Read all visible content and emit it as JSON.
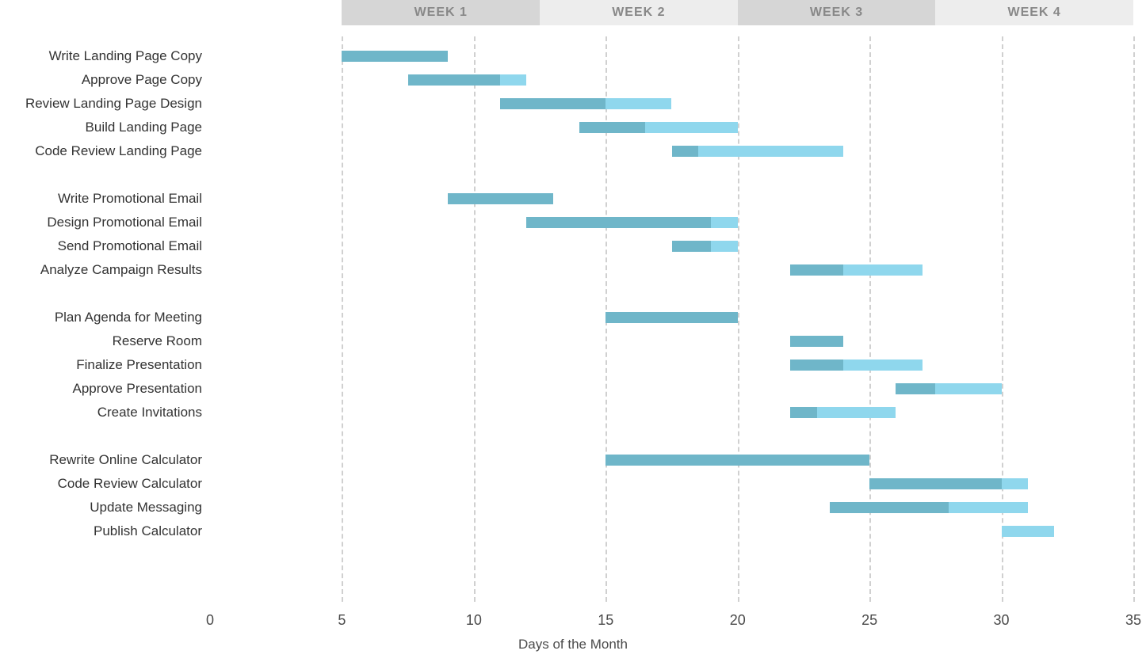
{
  "chart_data": {
    "type": "bar",
    "title": "",
    "xlabel": "Days of the Month",
    "ylabel": "",
    "xlim": [
      0,
      35
    ],
    "x_ticks": [
      0,
      5,
      10,
      15,
      20,
      25,
      30,
      35
    ],
    "week_headers": [
      "WEEK 1",
      "WEEK 2",
      "WEEK 3",
      "WEEK 4"
    ],
    "week_boundaries": [
      5,
      12.5,
      20,
      27.5,
      35
    ],
    "tasks": [
      {
        "label": "Write Landing Page Copy",
        "p_start": 5,
        "p_end": 9,
        "s_start": null,
        "s_end": null
      },
      {
        "label": "Approve Page Copy",
        "p_start": 7.5,
        "p_end": 11,
        "s_start": 11,
        "s_end": 12
      },
      {
        "label": "Review Landing Page Design",
        "p_start": 11,
        "p_end": 15,
        "s_start": 15,
        "s_end": 17.5
      },
      {
        "label": "Build Landing Page",
        "p_start": 14,
        "p_end": 16.5,
        "s_start": 16.5,
        "s_end": 20
      },
      {
        "label": "Code Review Landing Page",
        "p_start": 17.5,
        "p_end": 18.5,
        "s_start": 18.5,
        "s_end": 24
      },
      {
        "spacer": true
      },
      {
        "label": "Write Promotional Email",
        "p_start": 9,
        "p_end": 13,
        "s_start": null,
        "s_end": null
      },
      {
        "label": "Design Promotional Email",
        "p_start": 12,
        "p_end": 19,
        "s_start": 19,
        "s_end": 20
      },
      {
        "label": "Send Promotional Email",
        "p_start": 17.5,
        "p_end": 19,
        "s_start": 19,
        "s_end": 20
      },
      {
        "label": "Analyze Campaign Results",
        "p_start": 22,
        "p_end": 24,
        "s_start": 24,
        "s_end": 27
      },
      {
        "spacer": true
      },
      {
        "label": "Plan Agenda for Meeting",
        "p_start": 15,
        "p_end": 20,
        "s_start": null,
        "s_end": null
      },
      {
        "label": "Reserve Room",
        "p_start": 22,
        "p_end": 24,
        "s_start": null,
        "s_end": null
      },
      {
        "label": "Finalize Presentation",
        "p_start": 22,
        "p_end": 24,
        "s_start": 24,
        "s_end": 27
      },
      {
        "label": "Approve Presentation",
        "p_start": 26,
        "p_end": 27.5,
        "s_start": 27.5,
        "s_end": 30
      },
      {
        "label": "Create Invitations",
        "p_start": 22,
        "p_end": 23,
        "s_start": 23,
        "s_end": 26
      },
      {
        "spacer": true
      },
      {
        "label": "Rewrite Online Calculator",
        "p_start": 15,
        "p_end": 25,
        "s_start": null,
        "s_end": null
      },
      {
        "label": "Code Review Calculator",
        "p_start": 25,
        "p_end": 30,
        "s_start": 30,
        "s_end": 31
      },
      {
        "label": "Update Messaging",
        "p_start": 23.5,
        "p_end": 28,
        "s_start": 28,
        "s_end": 31
      },
      {
        "label": "Publish Calculator",
        "p_start": null,
        "p_end": null,
        "s_start": 30,
        "s_end": 32
      }
    ],
    "colors": {
      "primary": "#6fb6c9",
      "secondary": "#8fd7ed",
      "grid": "#d0d0d0"
    }
  }
}
